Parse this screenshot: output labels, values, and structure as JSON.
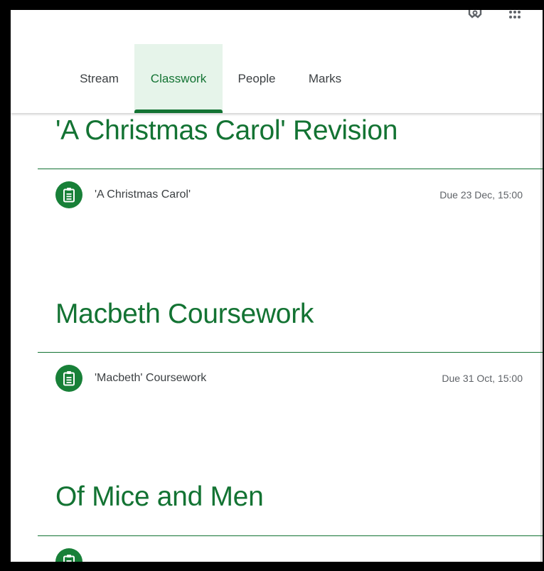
{
  "tabs": [
    {
      "label": "Stream"
    },
    {
      "label": "Classwork"
    },
    {
      "label": "People"
    },
    {
      "label": "Marks"
    }
  ],
  "colors": {
    "accent": "#137333",
    "icon_bg": "#188038",
    "active_tab_bg": "#e6f4ea"
  },
  "topics": [
    {
      "title": "'A Christmas Carol' Revision",
      "assignments": [
        {
          "title": "'A Christmas Carol'",
          "due": "Due 23 Dec, 15:00",
          "icon": "assignment-icon"
        }
      ]
    },
    {
      "title": "Macbeth Coursework",
      "assignments": [
        {
          "title": "'Macbeth' Coursework",
          "due": "Due 31 Oct, 15:00",
          "icon": "assignment-icon"
        }
      ]
    },
    {
      "title": "Of Mice and Men",
      "assignments": [
        {
          "icon": "assignment-icon"
        }
      ]
    }
  ],
  "header_icons": [
    "settings-icon",
    "apps-icon"
  ]
}
